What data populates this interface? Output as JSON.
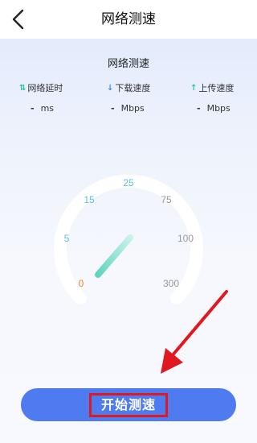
{
  "header": {
    "title": "网络测速",
    "back_icon": "chevron-left-icon"
  },
  "panel": {
    "title": "网络测速"
  },
  "metrics": [
    {
      "label": "网络延时",
      "icon": "swap-arrows-icon",
      "icon_color": "#23c4a0",
      "value": "-",
      "unit": "ms"
    },
    {
      "label": "下载速度",
      "icon": "arrow-down-icon",
      "icon_color": "#3a8ef0",
      "value": "-",
      "unit": "Mbps"
    },
    {
      "label": "上传速度",
      "icon": "arrow-up-icon",
      "icon_color": "#23c4a0",
      "value": "-",
      "unit": "Mbps"
    }
  ],
  "gauge": {
    "ticks": [
      "0",
      "5",
      "15",
      "25",
      "75",
      "100",
      "300"
    ],
    "tick_colors": [
      "#f08a2c",
      "#5bc0de",
      "#5bc0de",
      "#5bc0de",
      "#999999",
      "#999999",
      "#999999"
    ],
    "needle_color": "#7fe0cf"
  },
  "start_button": {
    "label": "开始测速"
  },
  "colors": {
    "accent": "#4f7bf0",
    "highlight_border": "#e0181f",
    "arrow": "#e0181f"
  }
}
